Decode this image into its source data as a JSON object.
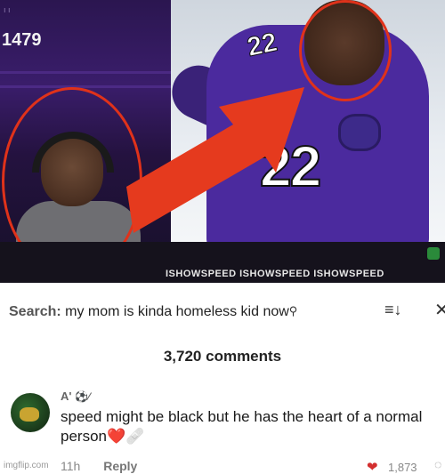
{
  "meme": {
    "stream_count": "1479",
    "stream_top_text": "ı   ı",
    "stream_sub_text": "",
    "jersey_number": "22",
    "shoulder_number": "22",
    "brand_strip_text": "ISHOWSPEED  ISHOWSPEED  ISHOWSPEED",
    "arrow_color": "#e53a1e",
    "circle_color": "#e0321a"
  },
  "search": {
    "label": "Search:",
    "term": "my mom is kinda homeless kid now",
    "search_icon": "search-icon",
    "sort_icon": "sort-icon",
    "close_icon": "close-icon"
  },
  "comments": {
    "count_title": "3,720 comments"
  },
  "comment": {
    "username": "A'",
    "badge": "⚽⁄",
    "text": "speed might be black but he has the heart of a normal person",
    "text_emoji": "❤️🩹",
    "time": "11h",
    "reply_label": "Reply",
    "likes": "1,873"
  },
  "watermark": {
    "text": "imgflip.com"
  }
}
